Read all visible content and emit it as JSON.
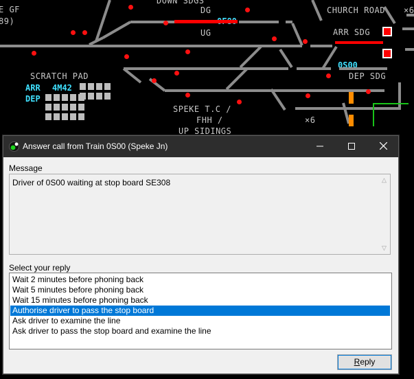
{
  "background": {
    "labels": {
      "top_left_fragment": "E GF",
      "top_left_fragment2": "89)",
      "down_sdgs": "DOWN SDGS",
      "dg": "DG",
      "ug": "UG",
      "church_road": "CHURCH ROAD",
      "top_right_fragment": "×6",
      "arr_sdg": "ARR SDG",
      "dep_sdg": "DEP SDG",
      "scratch_pad": "SCRATCH PAD",
      "arr": "ARR",
      "dep": "DEP",
      "speke_line1": "SPEKE T.C /",
      "speke_line2": "FHH /",
      "speke_line3": "UP SIDINGS",
      "x6": "×6"
    },
    "headcodes": {
      "dg_train": "0F80",
      "dep_train": "0S00",
      "arr_pad": "4M42"
    },
    "colors": {
      "track": "#8c8c8c",
      "occupied": "#ff0000",
      "headcode": "#3fe0ff",
      "signal_red": "#ff1010",
      "amber": "#ff8c00",
      "green": "#19c419"
    }
  },
  "dialog": {
    "title": "Answer call from Train 0S00 (Speke Jn)",
    "app_icon": "traffic-light-icon",
    "window_buttons": {
      "minimize": "—",
      "maximize": "☐",
      "close": "✕"
    },
    "message_label": "Message",
    "message": "Driver of 0S00 waiting at stop board SE308",
    "reply_label": "Select your reply",
    "replies": [
      "Wait 2 minutes before phoning back",
      "Wait 5 minutes before phoning back",
      "Wait 15 minutes before phoning back",
      "Authorise driver to pass the stop board",
      "Ask driver to examine the line",
      "Ask driver to pass the stop board and examine the line"
    ],
    "selected_reply": "Authorise driver to pass the stop board",
    "reply_button": {
      "mnemonic": "R",
      "rest": "eply"
    }
  }
}
